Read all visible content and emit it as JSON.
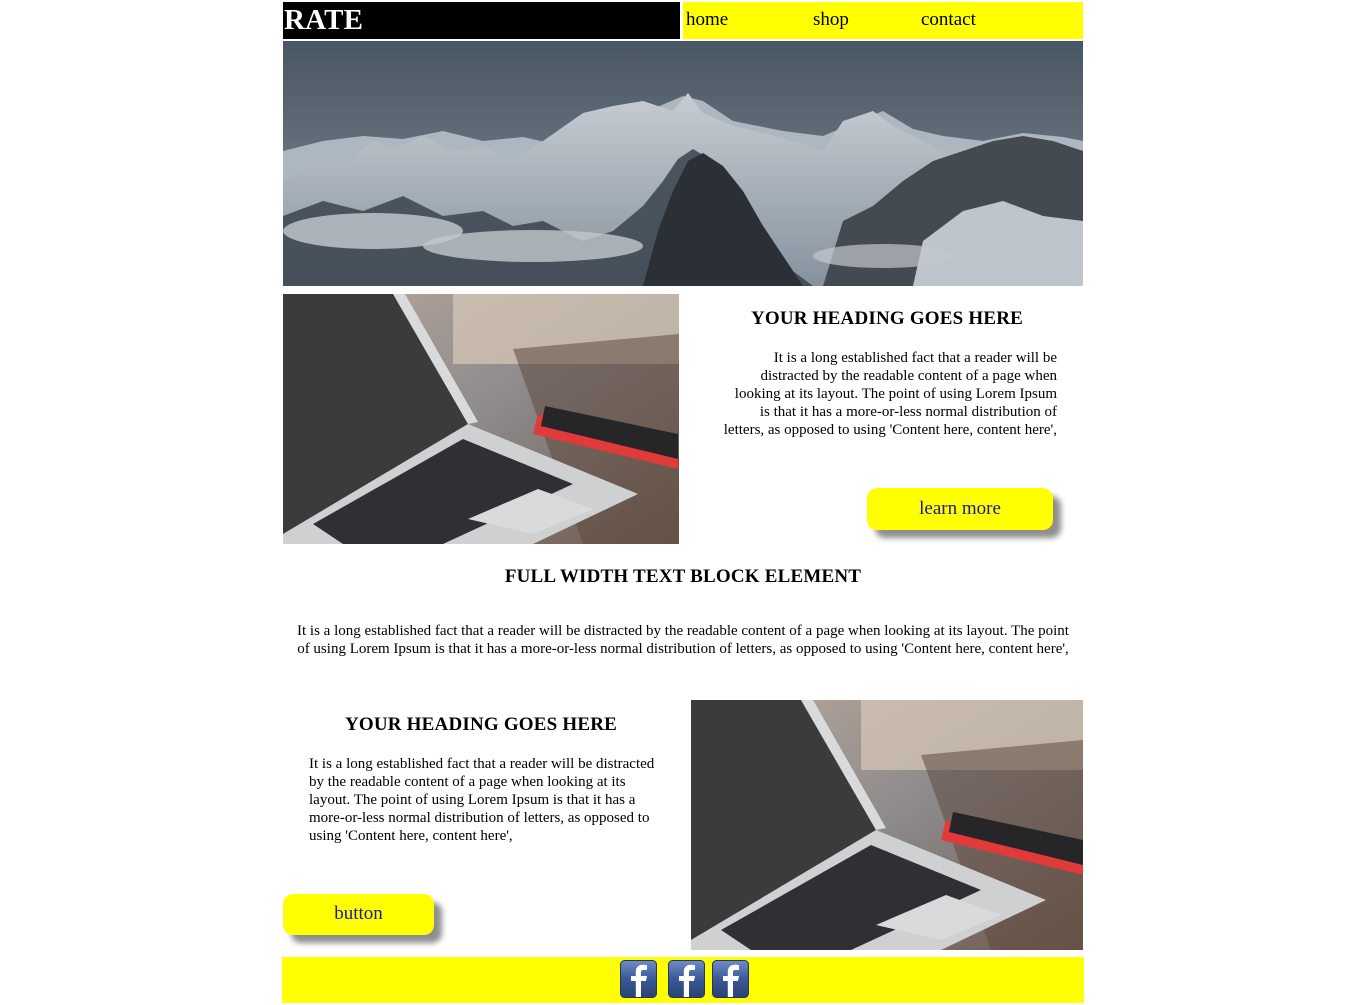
{
  "header": {
    "brand": "RATE",
    "nav": [
      "home",
      "shop",
      "contact"
    ]
  },
  "section1": {
    "heading": "YOUR HEADING GOES HERE",
    "text": "It is a long established fact that a reader will be distracted by the readable content of a page when looking at its layout. The point of using Lorem Ipsum is that it has a more-or-less normal distribution of letters, as opposed to using 'Content here, content here',",
    "button": "learn more"
  },
  "full_block": {
    "heading": "FULL WIDTH TEXT BLOCK ELEMENT",
    "text": "It is a long established fact that a reader will be distracted by the readable content of a page when looking at its layout. The point of using Lorem Ipsum is that it has a more-or-less normal distribution of letters, as opposed to using 'Content here, content here',"
  },
  "section2": {
    "heading": "YOUR HEADING GOES HERE",
    "text": "It is a long established fact that a reader will be distracted by the readable content of a page when looking at its layout. The point of using Lorem Ipsum is that it has a more-or-less normal distribution of letters, as opposed to using 'Content here, content here',",
    "button": "button"
  },
  "footer": {
    "icons": [
      "facebook-icon",
      "facebook-icon",
      "facebook-icon"
    ]
  },
  "colors": {
    "accent": "#ffff00",
    "brand_bg": "#000000",
    "link": "#1a1aa6",
    "facebook": "#3b5998"
  }
}
